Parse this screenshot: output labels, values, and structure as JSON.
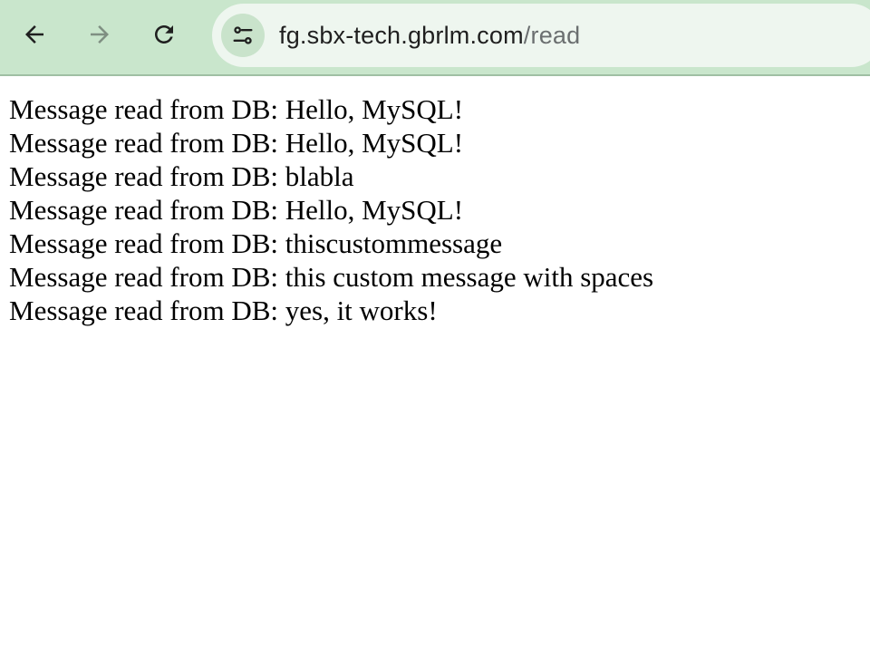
{
  "browser": {
    "url_host": "fg.sbx-tech.gbrlm.com",
    "url_path": "/read",
    "icons": {
      "back": "arrow-left-icon",
      "forward": "arrow-right-icon",
      "reload": "reload-icon",
      "site_info": "tune-icon"
    },
    "colors": {
      "toolbar": "#c9e6cc",
      "omnibox": "#eef6ef"
    }
  },
  "page": {
    "lines": [
      "Message read from DB: Hello, MySQL!",
      "Message read from DB: Hello, MySQL!",
      "Message read from DB: blabla",
      "Message read from DB: Hello, MySQL!",
      "Message read from DB: thiscustommessage",
      "Message read from DB: this custom message with spaces",
      "Message read from DB: yes, it works!"
    ]
  }
}
